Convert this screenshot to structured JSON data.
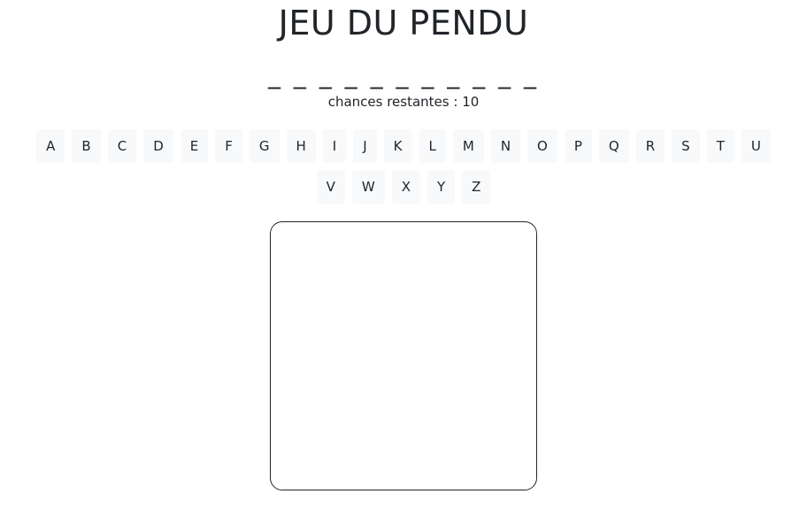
{
  "title": "JEU DU PENDU",
  "word_display": "_ _ _ _ _ _ _ _ _ _ _",
  "chances_text": "chances restantes : 10",
  "letters": [
    "A",
    "B",
    "C",
    "D",
    "E",
    "F",
    "G",
    "H",
    "I",
    "J",
    "K",
    "L",
    "M",
    "N",
    "O",
    "P",
    "Q",
    "R",
    "S",
    "T",
    "U",
    "V",
    "W",
    "X",
    "Y",
    "Z"
  ]
}
